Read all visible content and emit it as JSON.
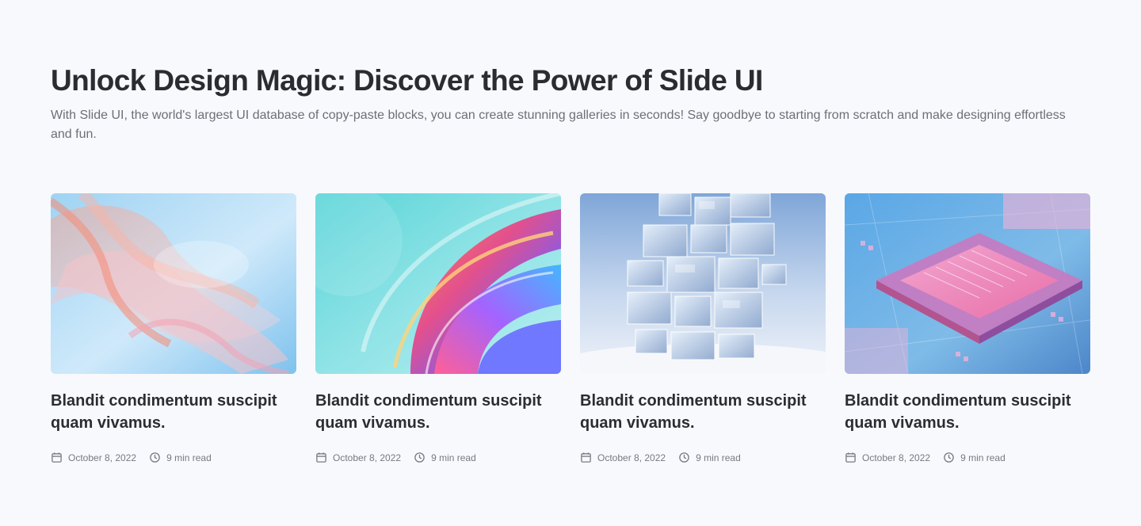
{
  "header": {
    "title": "Unlock Design Magic: Discover the Power of Slide UI",
    "subtitle": "With Slide UI, the world's largest UI database of copy-paste blocks, you can create stunning galleries in seconds! Say goodbye to starting from scratch and make designing effortless and fun."
  },
  "cards": [
    {
      "image": "abstract-glass-ribbons",
      "title": "Blandit condimentum suscipit quam vivamus.",
      "date": "October 8, 2022",
      "read_time": "9 min read"
    },
    {
      "image": "iridescent-glass-swirl",
      "title": "Blandit condimentum suscipit quam vivamus.",
      "date": "October 8, 2022",
      "read_time": "9 min read"
    },
    {
      "image": "glass-cube-tower",
      "title": "Blandit condimentum suscipit quam vivamus.",
      "date": "October 8, 2022",
      "read_time": "9 min read"
    },
    {
      "image": "neon-circuit-chip",
      "title": "Blandit condimentum suscipit quam vivamus.",
      "date": "October 8, 2022",
      "read_time": "9 min read"
    }
  ],
  "icons": {
    "date": "calendar-icon",
    "read_time": "clock-icon"
  }
}
